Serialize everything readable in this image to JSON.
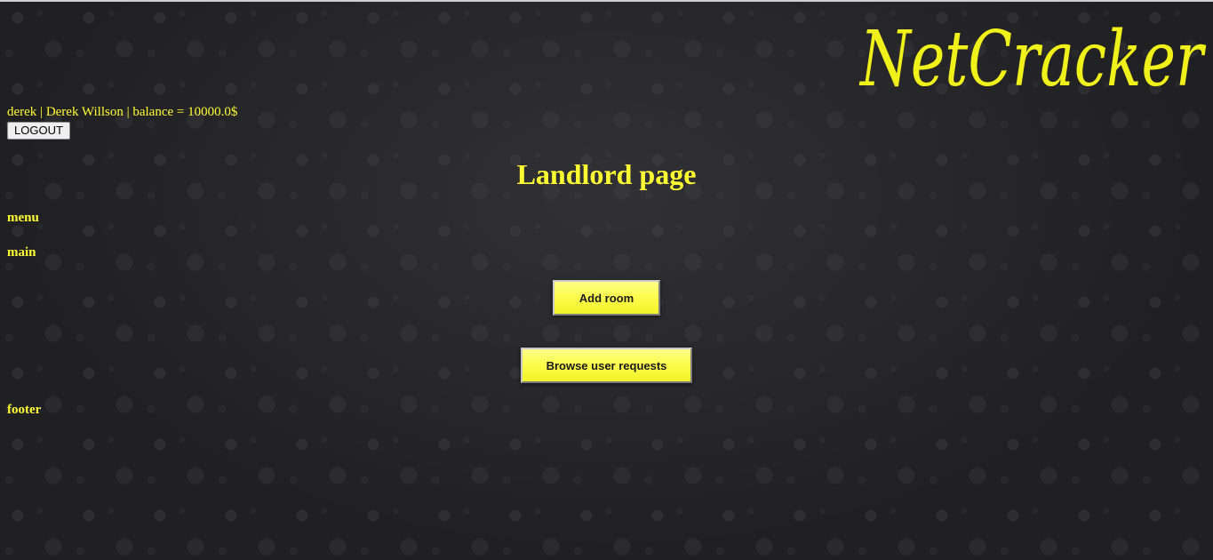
{
  "header": {
    "logo_text": "NetCracker",
    "user_info": "derek | Derek Willson | balance = 10000.0$",
    "logout_label": "LOGOUT"
  },
  "page": {
    "title": "Landlord page"
  },
  "sections": {
    "menu": "menu",
    "main": "main",
    "footer": "footer"
  },
  "actions": {
    "add_room": "Add room",
    "browse_requests": "Browse user requests"
  },
  "colors": {
    "accent": "#ffff33",
    "background": "#202022",
    "button_fill": "#fdfd4e"
  }
}
